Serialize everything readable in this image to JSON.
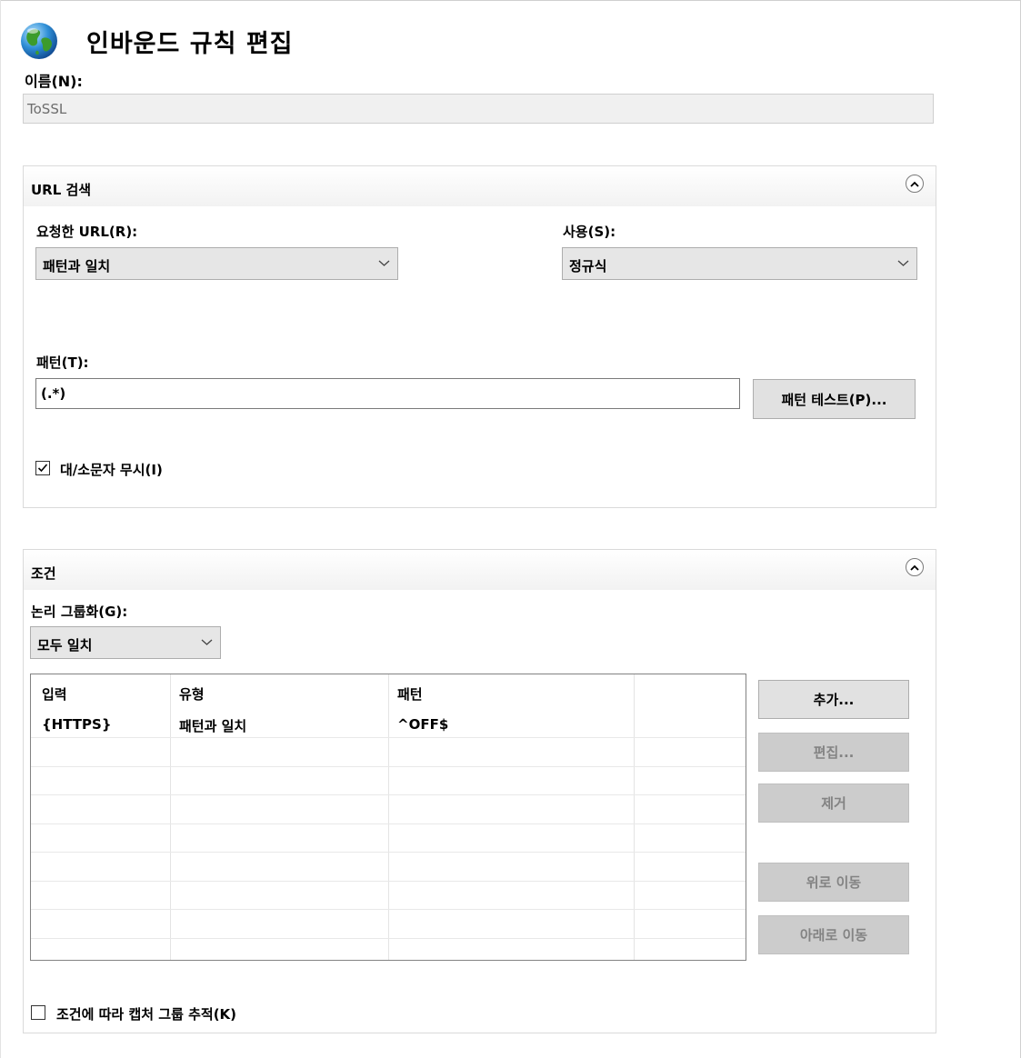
{
  "header": {
    "title": "인바운드 규칙 편집",
    "icon": "globe-icon"
  },
  "name": {
    "label": "이름(N):",
    "value": "ToSSL"
  },
  "url_match": {
    "section_title": "URL 검색",
    "requested_url": {
      "label": "요청한 URL(R):",
      "selected": "패턴과 일치"
    },
    "using": {
      "label": "사용(S):",
      "selected": "정규식"
    },
    "pattern": {
      "label": "패턴(T):",
      "value": "(.*)"
    },
    "test_button": "패턴 테스트(P)...",
    "ignore_case": {
      "label": "대/소문자 무시(I)",
      "checked": true
    }
  },
  "conditions": {
    "section_title": "조건",
    "grouping": {
      "label": "논리 그룹화(G):",
      "selected": "모두 일치"
    },
    "table": {
      "columns": [
        "입력",
        "유형",
        "패턴",
        ""
      ],
      "rows": [
        {
          "input": "{HTTPS}",
          "type": "패턴과 일치",
          "pattern": "^OFF$"
        }
      ]
    },
    "buttons": {
      "add": "추가...",
      "edit": "편집...",
      "remove": "제거",
      "move_up": "위로 이동",
      "move_down": "아래로 이동"
    },
    "track_capture": {
      "label": "조건에 따라 캡처 그룹 추적(K)",
      "checked": false
    }
  }
}
